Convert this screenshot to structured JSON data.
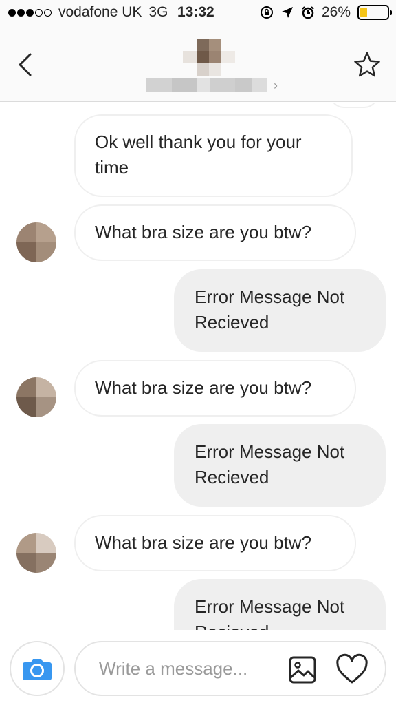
{
  "status_bar": {
    "signal_bars_filled": 3,
    "signal_bars_total": 5,
    "carrier": "vodafone UK",
    "network": "3G",
    "time": "13:32",
    "battery_percent": "26%",
    "battery_level": 0.26
  },
  "header": {
    "back_icon": "chevron-left-icon",
    "favorite_icon": "star-outline-icon",
    "chevron": "›"
  },
  "messages": [
    {
      "direction": "incoming",
      "text": "Ok well thank you for your time",
      "show_avatar": false
    },
    {
      "direction": "incoming",
      "text": "What bra size are you btw?",
      "show_avatar": true
    },
    {
      "direction": "outgoing",
      "text": "Error Message Not Recieved"
    },
    {
      "direction": "incoming",
      "text": "What bra size are you btw?",
      "show_avatar": true
    },
    {
      "direction": "outgoing",
      "text": "Error Message Not Recieved"
    },
    {
      "direction": "incoming",
      "text": "What bra size are you btw?",
      "show_avatar": true
    },
    {
      "direction": "outgoing",
      "text": "Error Message Not Recieved"
    }
  ],
  "composer": {
    "placeholder": "Write a message...",
    "camera_icon": "camera-icon",
    "gallery_icon": "image-icon",
    "like_icon": "heart-icon"
  },
  "colors": {
    "camera_accent": "#3897f0",
    "battery": "#f5c518",
    "outgoing_bubble": "#efefef",
    "bubble_border": "#efefef"
  }
}
